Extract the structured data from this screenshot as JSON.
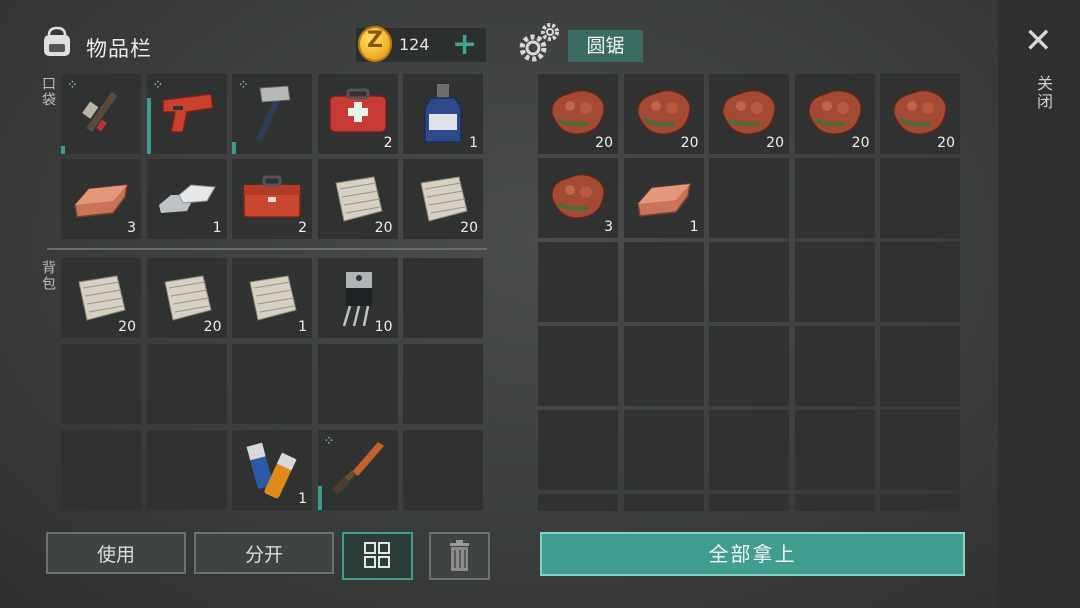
{
  "inventory": {
    "title": "物品栏",
    "pocket_label": "口袋",
    "backpack_label": "背包",
    "currency": {
      "count": "124",
      "coin_symbol": "Z",
      "add_symbol": "+"
    },
    "pocket_slots": [
      {
        "item": "shotgun-icon",
        "count": "",
        "durability": 0.1
      },
      {
        "item": "flare-gun-icon",
        "count": "",
        "durability": 0.7
      },
      {
        "item": "hatchet-icon",
        "count": "",
        "durability": 0.15
      },
      {
        "item": "first-aid-kit-icon",
        "count": "2"
      },
      {
        "item": "bottle-icon",
        "count": "1"
      },
      {
        "item": "copper-ingot-icon",
        "count": "3"
      },
      {
        "item": "silver-bars-icon",
        "count": "1"
      },
      {
        "item": "toolbox-icon",
        "count": "2"
      },
      {
        "item": "cloth-icon",
        "count": "20"
      },
      {
        "item": "cloth-icon",
        "count": "20"
      }
    ],
    "backpack_slots": [
      {
        "item": "cloth-icon",
        "count": "20"
      },
      {
        "item": "cloth-icon",
        "count": "20"
      },
      {
        "item": "cloth-icon",
        "count": "1"
      },
      {
        "item": "transistor-icon",
        "count": "10"
      },
      {
        "item": "",
        "count": ""
      },
      {
        "item": "",
        "count": ""
      },
      {
        "item": "",
        "count": ""
      },
      {
        "item": "",
        "count": ""
      },
      {
        "item": "",
        "count": ""
      },
      {
        "item": "",
        "count": ""
      },
      {
        "item": "",
        "count": ""
      },
      {
        "item": "",
        "count": ""
      },
      {
        "item": "batteries-icon",
        "count": "1"
      },
      {
        "item": "knife-icon",
        "count": "",
        "durability": 0.3
      },
      {
        "item": "",
        "count": ""
      }
    ],
    "buttons": {
      "use": "使用",
      "split": "分开",
      "grid_icon": "grid-icon",
      "trash_icon": "trash-icon"
    }
  },
  "container": {
    "title": "圆锯",
    "slots": [
      {
        "item": "copper-ore-icon",
        "count": "20"
      },
      {
        "item": "copper-ore-icon",
        "count": "20"
      },
      {
        "item": "copper-ore-icon",
        "count": "20"
      },
      {
        "item": "copper-ore-icon",
        "count": "20"
      },
      {
        "item": "copper-ore-icon",
        "count": "20"
      },
      {
        "item": "copper-ore-icon",
        "count": "3"
      },
      {
        "item": "copper-ingot-icon",
        "count": "1"
      }
    ],
    "take_all": "全部拿上"
  },
  "close": {
    "label": "关闭",
    "icon": "close-icon"
  },
  "colors": {
    "accent": "#3f9e8f",
    "slot": "#2f3231",
    "background": "#3b3e3c"
  }
}
